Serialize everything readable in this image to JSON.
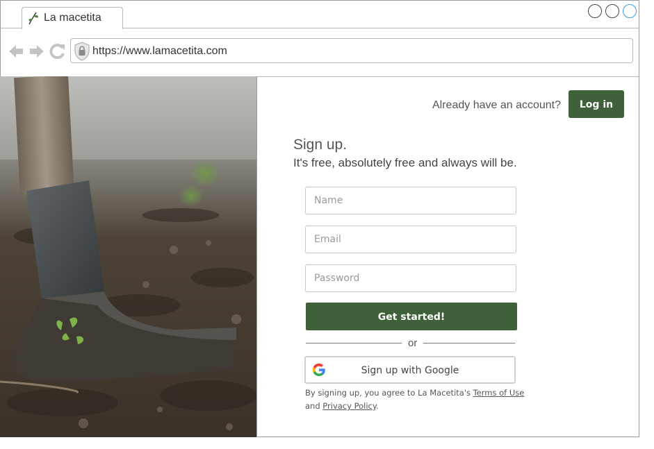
{
  "browser": {
    "tab_title": "La macetita",
    "url": "https://www.lamacetita.com"
  },
  "header": {
    "already_text": "Already have an account?",
    "login_label": "Log in"
  },
  "signup": {
    "heading": "Sign up.",
    "subheading": "It's free, absolutely free and always will be.",
    "name_placeholder": "Name",
    "email_placeholder": "Email",
    "password_placeholder": "Password",
    "submit_label": "Get started!",
    "or_text": "or",
    "google_label": "Sign up with Google"
  },
  "legal": {
    "prefix": "By signing up, you agree to La Macetita's",
    "terms_link": "Terms of Use",
    "and_text": "and",
    "privacy_link": "Privacy Policy",
    "suffix": "."
  },
  "colors": {
    "brand_green": "#3f6139"
  }
}
